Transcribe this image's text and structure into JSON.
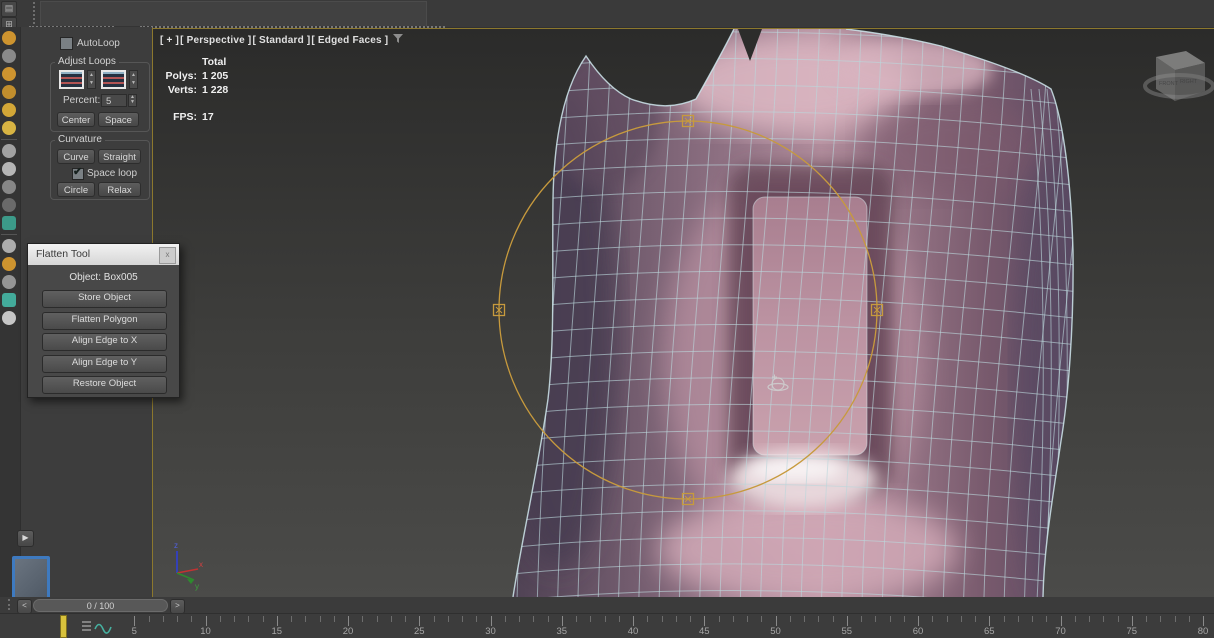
{
  "top_toolbar": {
    "icon1": "▤",
    "icon2": "⊞"
  },
  "left_toolbar": {
    "icons": [
      {
        "name": "freeform-tool-1",
        "color": "#d79a2f",
        "shape": "round"
      },
      {
        "name": "freeform-tool-2",
        "color": "#8f8f8f",
        "shape": "round"
      },
      {
        "name": "freeform-strips",
        "color": "#d79a2f",
        "shape": "round"
      },
      {
        "name": "conform-brush",
        "color": "#c9932d",
        "shape": "round"
      },
      {
        "name": "splatter-brush",
        "color": "#dcae38",
        "shape": "round"
      },
      {
        "name": "sun-brush",
        "color": "#e2bc45",
        "shape": "round"
      },
      {
        "name": "divider"
      },
      {
        "name": "paint-sphere-1",
        "color": "#a9a9a9",
        "shape": "round"
      },
      {
        "name": "paint-sphere-2",
        "color": "#bdbdbd",
        "shape": "round"
      },
      {
        "name": "paint-sphere-3",
        "color": "#8c8c8c",
        "shape": "round"
      },
      {
        "name": "paint-sphere-4",
        "color": "#6e6e6e",
        "shape": "round"
      },
      {
        "name": "paint-box",
        "color": "#3da08e",
        "shape": "square"
      },
      {
        "name": "divider"
      },
      {
        "name": "deform-sphere",
        "color": "#b3b3b3",
        "shape": "round"
      },
      {
        "name": "deform-dots",
        "color": "#d79a2f",
        "shape": "round"
      },
      {
        "name": "deform-blob",
        "color": "#9b9b9b",
        "shape": "round"
      },
      {
        "name": "deform-box",
        "color": "#45b2a1",
        "shape": "square"
      },
      {
        "name": "deform-half",
        "color": "#cfcfcf",
        "shape": "round"
      }
    ]
  },
  "panel": {
    "autoloop_label": "AutoLoop",
    "adjust_loops": {
      "title": "Adjust Loops",
      "percent_label": "Percent:",
      "percent_value": "5",
      "center_button": "Center",
      "space_button": "Space"
    },
    "curvature": {
      "title": "Curvature",
      "curve_button": "Curve",
      "straight_button": "Straight",
      "space_loop_label": "Space loop",
      "space_loop_checked": "✔",
      "circle_button": "Circle",
      "relax_button": "Relax"
    },
    "play_button": "▶"
  },
  "flatten_tool": {
    "title": "Flatten Tool",
    "close": "x",
    "object_label": "Object: Box005",
    "buttons": [
      "Store Object",
      "Flatten Polygon",
      "Align Edge to X",
      "Align Edge to Y",
      "Restore Object"
    ]
  },
  "viewport": {
    "label_segments": [
      "[ + ]",
      "[ Perspective ]",
      "[ Standard ]",
      "[ Edged Faces ]"
    ],
    "stats": {
      "total_label": "Total",
      "polys_label": "Polys:",
      "polys_value": "1 205",
      "verts_label": "Verts:",
      "verts_value": "1 228",
      "fps_label": "FPS:",
      "fps_value": "17"
    },
    "axis_labels": {
      "x": "x",
      "y": "y",
      "z": "z"
    },
    "viewcube_labels": {
      "front": "FRONT",
      "right": "RIGHT"
    }
  },
  "timeline": {
    "prev": "<",
    "next": ">",
    "slider_value": "0 / 100",
    "start": 0,
    "visible_end": 80,
    "label_step": 5,
    "current_frame": 0
  },
  "colors": {
    "accent_orange": "#c79a3d",
    "wireframe": "#bcd6dc",
    "marker_yellow": "#d8c23c",
    "viewport_border": "#8c782d",
    "selection_blue": "#3e7ac0"
  }
}
